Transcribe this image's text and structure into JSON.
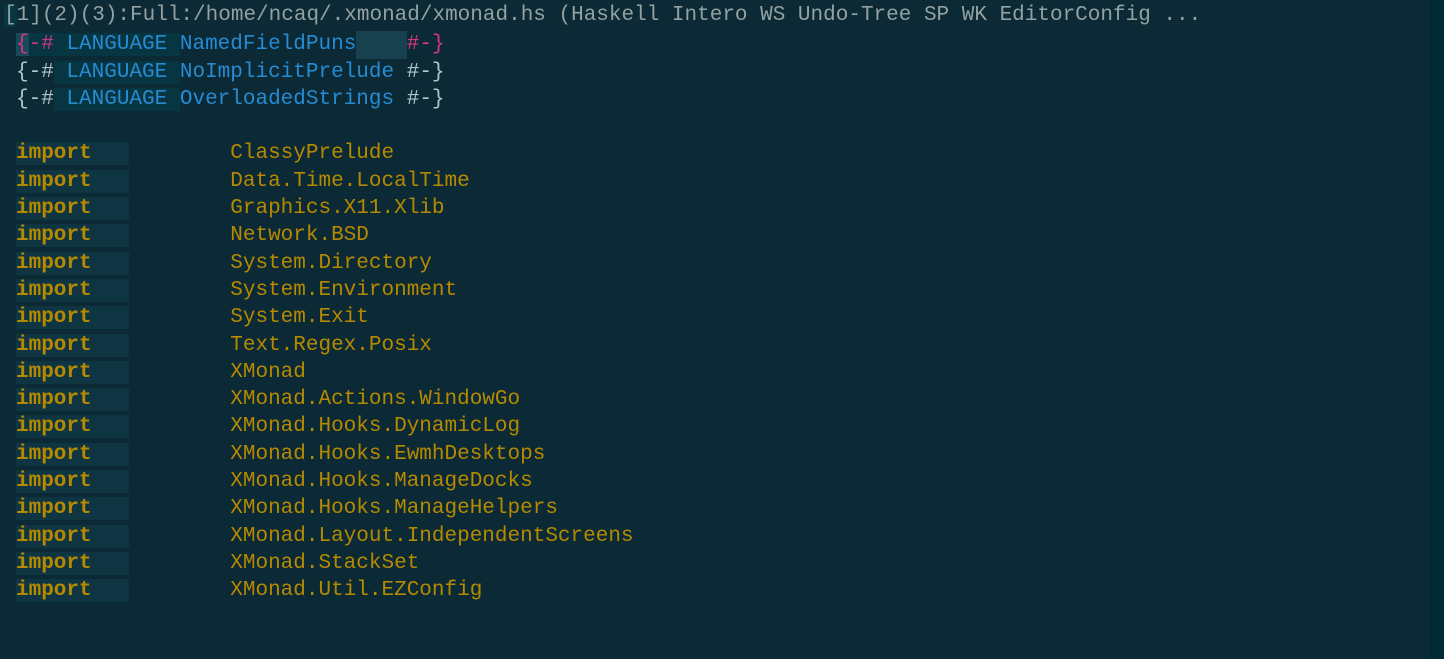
{
  "header": {
    "text": "[1](2)(3):Full:/home/ncaq/.xmonad/xmonad.hs (Haskell Intero WS Undo-Tree SP WK EditorConfig ..."
  },
  "pragmas": [
    {
      "name": "NamedFieldPuns",
      "active": true,
      "padding": "    "
    },
    {
      "name": "NoImplicitPrelude",
      "active": false,
      "padding": " "
    },
    {
      "name": "OverloadedStrings",
      "active": false,
      "padding": " "
    }
  ],
  "imports": [
    "ClassyPrelude",
    "Data.Time.LocalTime",
    "Graphics.X11.Xlib",
    "Network.BSD",
    "System.Directory",
    "System.Environment",
    "System.Exit",
    "Text.Regex.Posix",
    "XMonad",
    "XMonad.Actions.WindowGo",
    "XMonad.Hooks.DynamicLog",
    "XMonad.Hooks.EwmhDesktops",
    "XMonad.Hooks.ManageDocks",
    "XMonad.Hooks.ManageHelpers",
    "XMonad.Layout.IndependentScreens",
    "XMonad.StackSet",
    "XMonad.Util.EZConfig"
  ],
  "keywords": {
    "language": "LANGUAGE",
    "import": "import",
    "pragma_open": "{-#",
    "pragma_close": "#-}"
  }
}
